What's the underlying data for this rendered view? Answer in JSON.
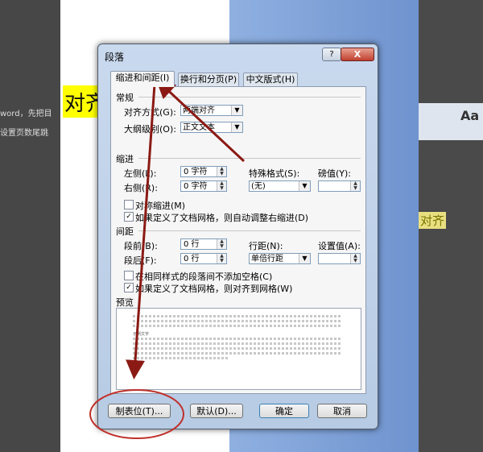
{
  "background": {
    "left_text_lines": [
      "word，先把目",
      "设置页数尾跳"
    ],
    "big_text": "对齐",
    "right_text": "对齐",
    "ribbon_labels": [
      "",
      "",
      "Aa"
    ]
  },
  "dialog": {
    "title": "段落",
    "help_label": "?",
    "close_label": "X",
    "tabs": [
      "缩进和间距(I)",
      "换行和分页(P)",
      "中文版式(H)"
    ],
    "general": {
      "section": "常规",
      "alignment_label": "对齐方式(G):",
      "alignment_value": "两端对齐",
      "outline_label": "大纲级别(O):",
      "outline_value": "正文文本"
    },
    "indent": {
      "section": "缩进",
      "left_label": "左侧(L):",
      "left_value": "0 字符",
      "right_label": "右侧(R):",
      "right_value": "0 字符",
      "special_label": "特殊格式(S):",
      "special_value": "(无)",
      "by_label": "磅值(Y):",
      "by_value": "",
      "mirror_label": "对称缩进(M)",
      "mirror_checked": false,
      "autoadjust_label": "如果定义了文档网格，则自动调整右缩进(D)",
      "autoadjust_checked": true
    },
    "spacing": {
      "section": "间距",
      "before_label": "段前(B):",
      "before_value": "0 行",
      "after_label": "段后(F):",
      "after_value": "0 行",
      "line_label": "行距(N):",
      "line_value": "单倍行距",
      "at_label": "设置值(A):",
      "at_value": "",
      "nospace_label": "在相同样式的段落间不添加空格(C)",
      "nospace_checked": false,
      "snapgrid_label": "如果定义了文档网格，则对齐到网格(W)",
      "snapgrid_checked": true
    },
    "preview": {
      "section": "预览",
      "sample": "示例文字"
    },
    "buttons": {
      "tabs_label": "制表位(T)...",
      "default_label": "默认(D)...",
      "ok_label": "确定",
      "cancel_label": "取消"
    }
  },
  "colors": {
    "annotation": "#c0302a",
    "highlight": "#ffff00"
  }
}
